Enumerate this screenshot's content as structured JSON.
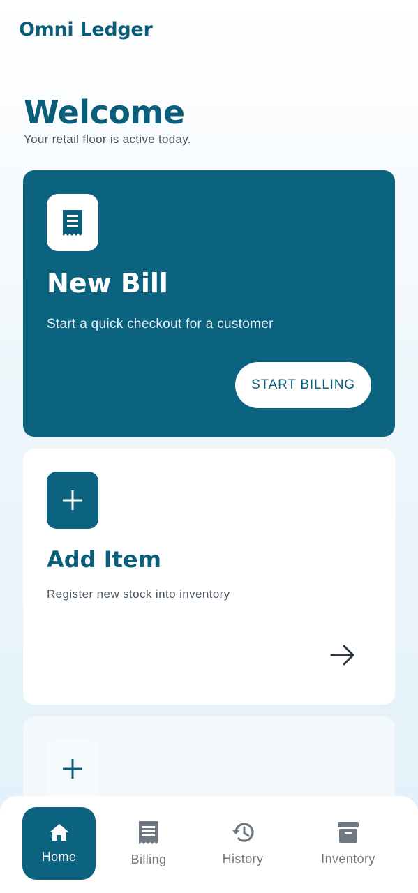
{
  "header": {
    "app_title": "Omni Ledger"
  },
  "welcome": {
    "title": "Welcome",
    "subtitle": "Your retail floor is active today."
  },
  "cards": {
    "new_bill": {
      "icon": "receipt-icon",
      "title": "New Bill",
      "description": "Start a quick checkout for a customer",
      "button_label": "START BILLING"
    },
    "add_item": {
      "icon": "plus-icon",
      "title": "Add Item",
      "description": "Register new stock into inventory",
      "action_icon": "arrow-right-icon"
    },
    "third": {
      "icon": "plus-icon"
    }
  },
  "bottom_nav": {
    "items": [
      {
        "label": "Home",
        "icon": "home-icon",
        "active": true
      },
      {
        "label": "Billing",
        "icon": "receipt-icon",
        "active": false
      },
      {
        "label": "History",
        "icon": "history-icon",
        "active": false
      },
      {
        "label": "Inventory",
        "icon": "archive-box-icon",
        "active": false
      }
    ]
  },
  "colors": {
    "primary": "#0b6380",
    "text_primary": "#0b5e7a",
    "text_secondary": "#4a5560",
    "nav_inactive": "#6f7880"
  }
}
